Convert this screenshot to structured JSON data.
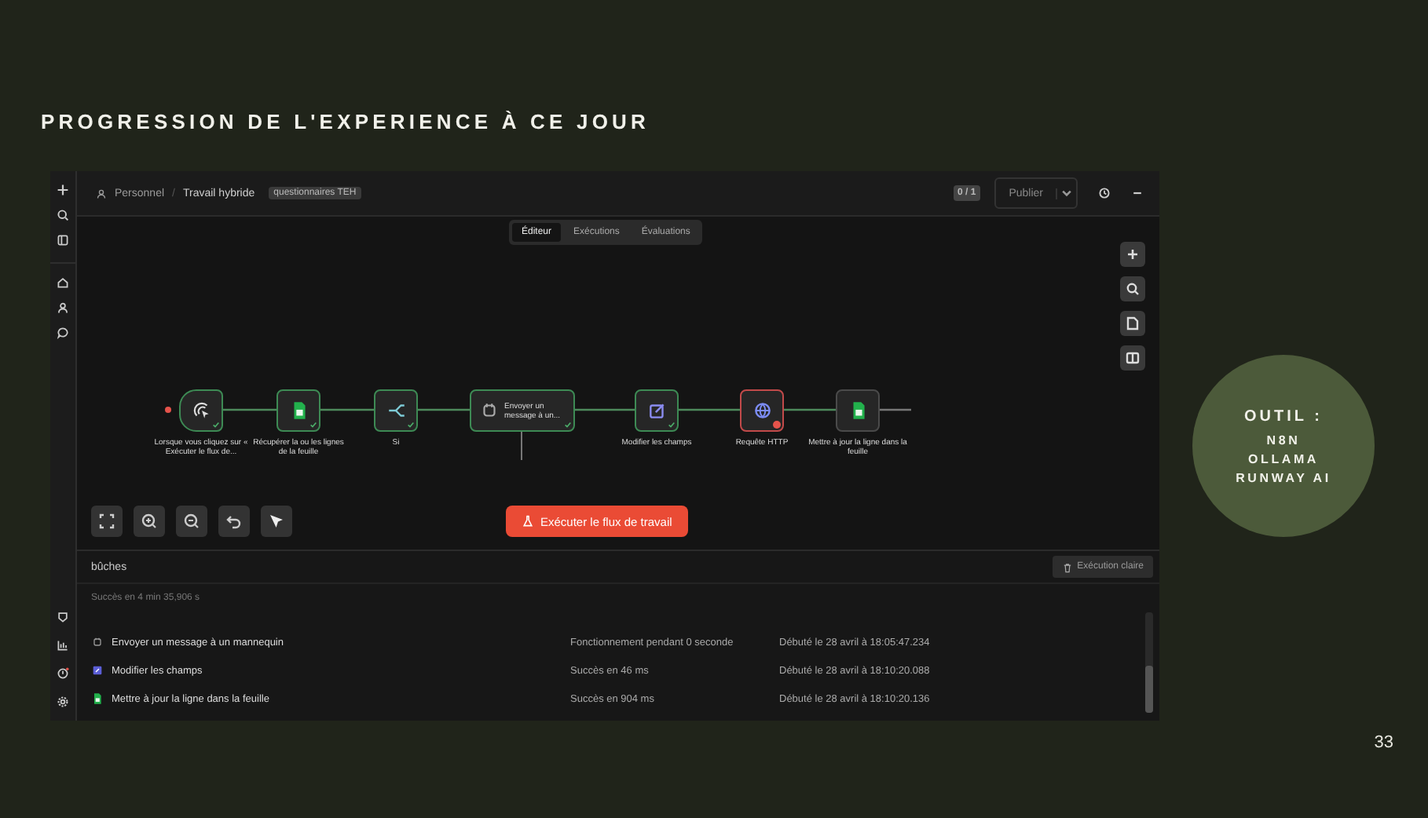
{
  "slide": {
    "title": "PROGRESSION DE L'EXPERIENCE À CE JOUR",
    "page_number": "33"
  },
  "tool_circle": {
    "heading": "OUTIL :",
    "items": [
      "N8N",
      "OLLAMA",
      "RUNWAY AI"
    ]
  },
  "header": {
    "breadcrumb": [
      "Personnel",
      "Travail hybride"
    ],
    "separator": "/",
    "tag": "questionnaires TEH",
    "counter": "0 / 1",
    "publish": "Publier"
  },
  "tabs": [
    {
      "label": "Éditeur",
      "selected": true
    },
    {
      "label": "Exécutions",
      "selected": false
    },
    {
      "label": "Évaluations",
      "selected": false
    }
  ],
  "nodes": [
    {
      "kind": "trigger",
      "executed": true,
      "error": false,
      "label": "Lorsque vous cliquez sur « Exécuter le flux de..."
    },
    {
      "kind": "sheets",
      "executed": true,
      "error": false,
      "label": "Récupérer la ou les lignes de la feuille"
    },
    {
      "kind": "if",
      "executed": true,
      "error": false,
      "label": "Si"
    },
    {
      "kind": "message",
      "executed": true,
      "error": false,
      "label": "Envoyer un message à un..."
    },
    {
      "kind": "edit",
      "executed": true,
      "error": false,
      "label": "Modifier les champs"
    },
    {
      "kind": "http",
      "executed": false,
      "error": true,
      "label": "Requête HTTP"
    },
    {
      "kind": "sheets",
      "executed": false,
      "error": false,
      "label": "Mettre à jour la ligne dans la feuille"
    }
  ],
  "run_button": "Exécuter le flux de travail",
  "logs": {
    "title": "bûches",
    "clear_button": "Exécution claire",
    "summary": "Succès en 4 min 35,906 s",
    "rows": [
      {
        "kind": "message",
        "name": "Envoyer un message à un mannequin",
        "status": "Fonctionnement pendant 0 seconde",
        "started": "Débuté le 28 avril à 18:05:47.234"
      },
      {
        "kind": "edit",
        "name": "Modifier les champs",
        "status": "Succès en 46 ms",
        "started": "Débuté le 28 avril à 18:10:20.088"
      },
      {
        "kind": "sheets",
        "name": "Mettre à jour la ligne dans la feuille",
        "status": "Succès en 904 ms",
        "started": "Débuté le 28 avril à 18:10:20.136"
      }
    ]
  }
}
